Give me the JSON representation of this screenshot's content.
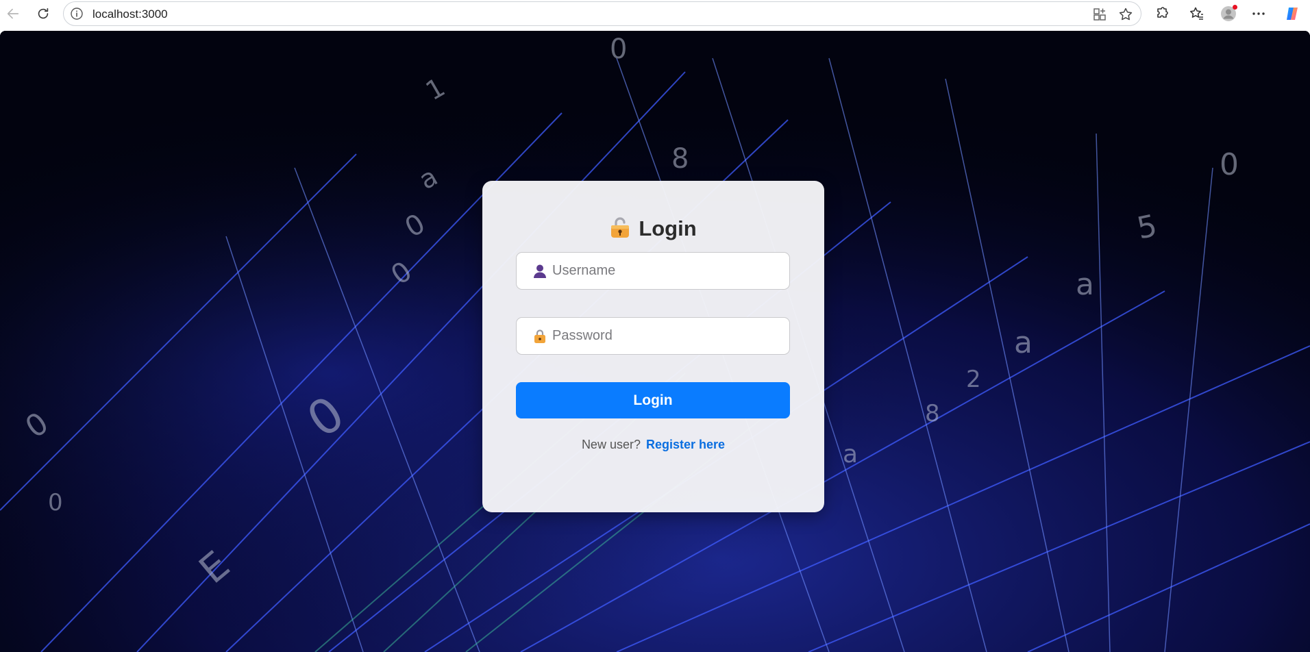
{
  "browser": {
    "url": "localhost:3000",
    "icons": {
      "back": "back-arrow-icon",
      "refresh": "refresh-icon",
      "site_info": "info-icon",
      "app": "app-available-icon",
      "favorite": "star-icon",
      "extensions": "puzzle-icon",
      "favorites": "favorites-icon",
      "profile": "avatar",
      "more": "more-icon",
      "copilot": "copilot-icon"
    },
    "profile_badge_color": "#e81123"
  },
  "login": {
    "title": "Login",
    "title_icon": "lock-icon",
    "username": {
      "icon": "user-icon",
      "placeholder": "Username",
      "value": ""
    },
    "password": {
      "icon": "lock-icon",
      "placeholder": "Password",
      "value": ""
    },
    "submit_label": "Login",
    "register_prompt": "New user?",
    "register_link": "Register here"
  },
  "colors": {
    "accent": "#0a7cff",
    "link": "#0a6ee0",
    "card_bg": "#f4f4f7",
    "page_bg": "#03051a"
  }
}
